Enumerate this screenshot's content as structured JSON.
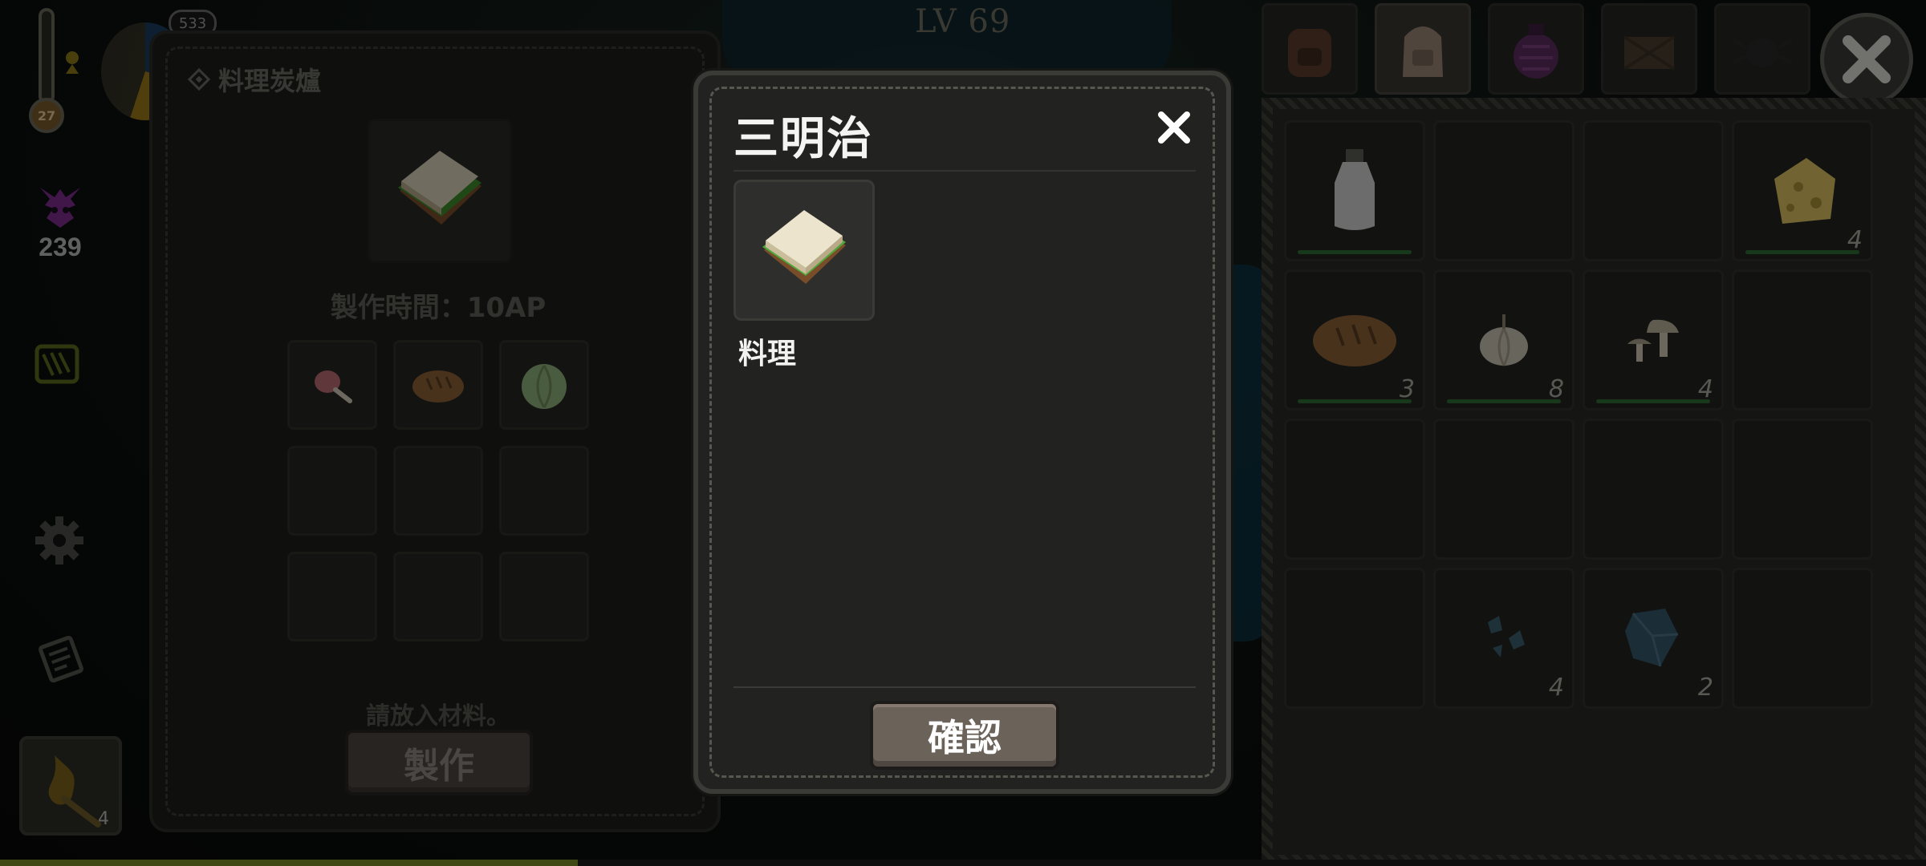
{
  "hud": {
    "temperature": "27",
    "top_badge": "533",
    "curse_value": "239",
    "torch_count": "4"
  },
  "level_label": "LV 69",
  "cooking_panel": {
    "title": "料理炭爐",
    "craft_time": "製作時間：10AP",
    "placeholder_message": "請放入材料。",
    "craft_button": "製作",
    "ingredients": [
      "meat-drumstick",
      "bread-loaf",
      "cabbage",
      "",
      "",
      "",
      "",
      "",
      ""
    ]
  },
  "inventory": {
    "tabs": [
      "backpack-brown",
      "backpack-tan",
      "bag-purple",
      "crate",
      "spider-pouch"
    ],
    "active_tab": 1,
    "slots": [
      {
        "icon": "milk-bottle",
        "count": "",
        "durability": 1.0
      },
      {
        "icon": "",
        "count": "",
        "durability": null
      },
      {
        "icon": "",
        "count": "",
        "durability": null
      },
      {
        "icon": "cheese",
        "count": "4",
        "durability": 1.0
      },
      {
        "icon": "bread",
        "count": "3",
        "durability": 1.0
      },
      {
        "icon": "garlic",
        "count": "8",
        "durability": 1.0
      },
      {
        "icon": "mushrooms",
        "count": "4",
        "durability": 1.0
      },
      {
        "icon": "",
        "count": "",
        "durability": null
      },
      {
        "icon": "",
        "count": "",
        "durability": null
      },
      {
        "icon": "",
        "count": "",
        "durability": null
      },
      {
        "icon": "",
        "count": "",
        "durability": null
      },
      {
        "icon": "",
        "count": "",
        "durability": null
      },
      {
        "icon": "",
        "count": "",
        "durability": null
      },
      {
        "icon": "crystal-shards",
        "count": "4",
        "durability": null
      },
      {
        "icon": "blue-crystal",
        "count": "2",
        "durability": null
      },
      {
        "icon": "",
        "count": "",
        "durability": null
      }
    ]
  },
  "dialog": {
    "title": "三明治",
    "item_icon": "sandwich",
    "category": "料理",
    "confirm_button": "確認"
  },
  "colors": {
    "accent_brown": "#6b625a",
    "durability_green": "#2e6b34",
    "curse_purple": "#7d2c8f"
  }
}
